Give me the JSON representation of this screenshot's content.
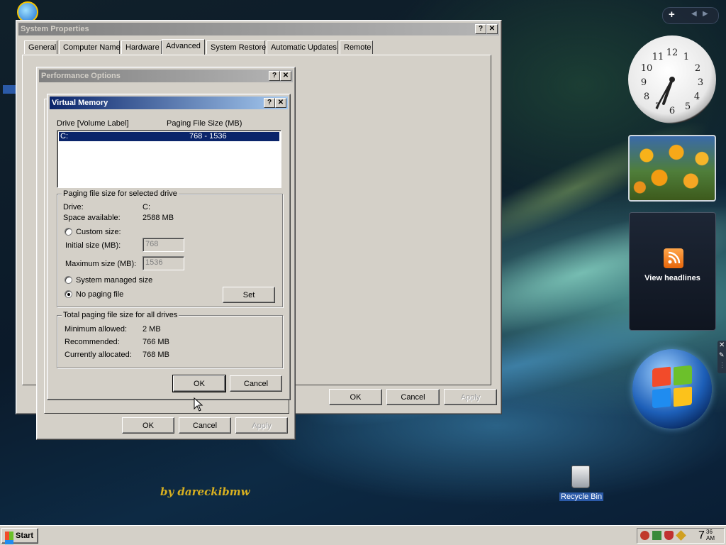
{
  "system_properties": {
    "title": "System Properties",
    "tabs": [
      "General",
      "Computer Name",
      "Hardware",
      "Advanced",
      "System Restore",
      "Automatic Updates",
      "Remote"
    ],
    "selected_tab": "Advanced",
    "buttons": {
      "ok": "OK",
      "cancel": "Cancel",
      "apply": "Apply"
    }
  },
  "performance_options": {
    "title": "Performance Options",
    "buttons": {
      "ok": "OK",
      "cancel": "Cancel",
      "apply": "Apply"
    }
  },
  "virtual_memory": {
    "title": "Virtual Memory",
    "list_headers": {
      "drive": "Drive  [Volume Label]",
      "paging": "Paging File Size (MB)"
    },
    "drives": [
      {
        "drive": "C:",
        "paging": "768 - 1536"
      }
    ],
    "selected_group": {
      "label": "Paging file size for selected drive",
      "drive_label": "Drive:",
      "drive_value": "C:",
      "space_label": "Space available:",
      "space_value": "2588 MB",
      "custom_size": "Custom size:",
      "initial_label": "Initial size (MB):",
      "initial_value": "768",
      "max_label": "Maximum size (MB):",
      "max_value": "1536",
      "system_managed": "System managed size",
      "no_paging": "No paging file",
      "selected_option": "No paging file",
      "set_button": "Set"
    },
    "total_group": {
      "label": "Total paging file size for all drives",
      "min_label": "Minimum allowed:",
      "min_value": "2 MB",
      "rec_label": "Recommended:",
      "rec_value": "766 MB",
      "cur_label": "Currently allocated:",
      "cur_value": "768 MB"
    },
    "buttons": {
      "ok": "OK",
      "cancel": "Cancel"
    }
  },
  "sidebar": {
    "add_button": "+",
    "feed_label": "View headlines",
    "clock": {
      "hour": 7,
      "minute": 36
    }
  },
  "desktop": {
    "recycle_bin": "Recycle Bin",
    "watermark": "by dareckibmw"
  },
  "taskbar": {
    "start": "Start",
    "time_hour": "7",
    "time_min": "36",
    "time_ampm": "AM"
  },
  "colors": {
    "title_active": "#0a246a",
    "title_inactive": "#808080",
    "selection": "#0a246a",
    "dialog_face": "#d4d0c8"
  }
}
